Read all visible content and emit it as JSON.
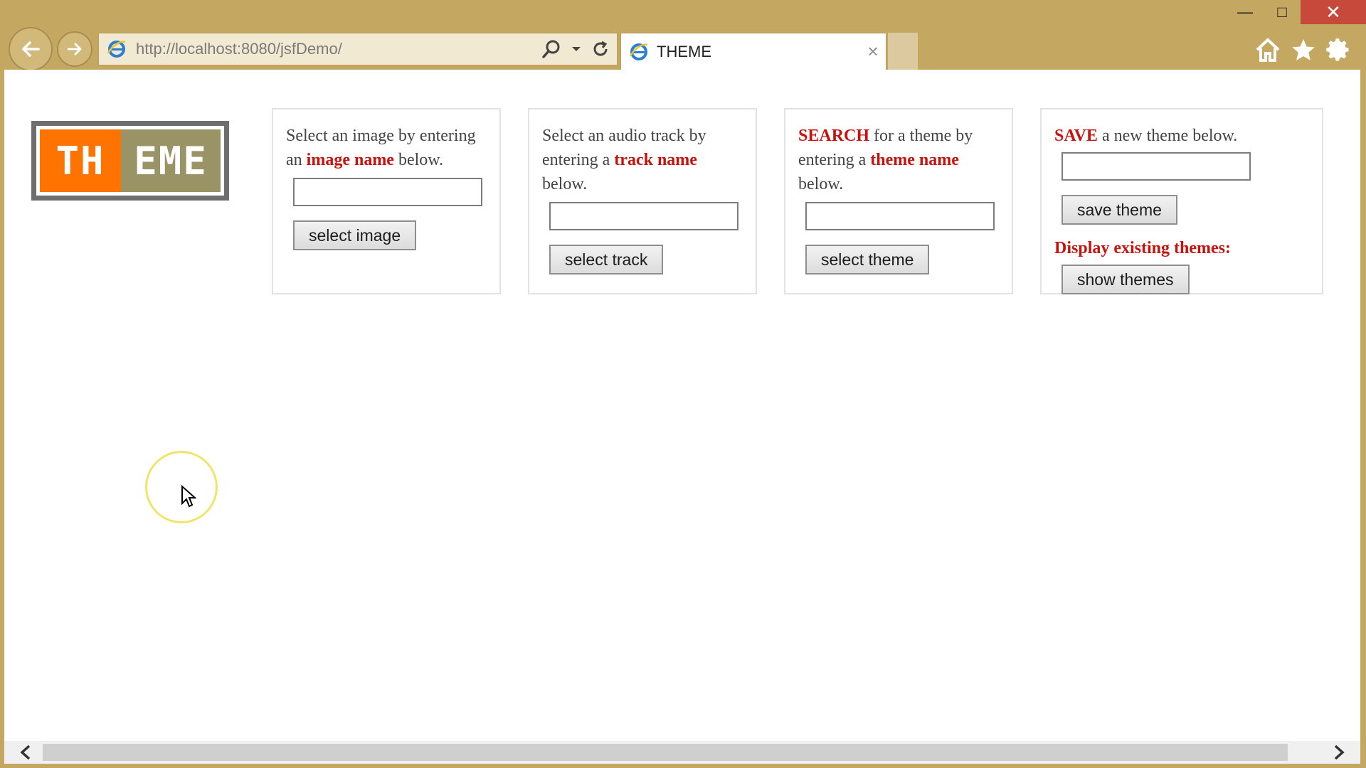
{
  "window": {
    "minimize_icon": "minimize-icon",
    "maximize_icon": "maximize-icon",
    "close_icon": "close-icon"
  },
  "browser": {
    "url_host": "http://localhost",
    "url_rest": ":8080/jsfDemo/",
    "tab_title": "THEME",
    "tab_close": "×"
  },
  "logo": {
    "left_text": "TH",
    "right_text": "EME"
  },
  "panels": {
    "image": {
      "text_before": "Select an image by entering an ",
      "highlight": "image name",
      "text_after": " below.",
      "button": "select image"
    },
    "track": {
      "text_before": "Select an audio track by entering a ",
      "highlight": "track name",
      "text_after": " below.",
      "button": "select track"
    },
    "search": {
      "lead": "SEARCH",
      "text_mid": " for a theme by entering a ",
      "highlight": "theme name",
      "text_after": " below.",
      "button": "select theme"
    },
    "save": {
      "lead": "SAVE",
      "text_after": " a new theme below.",
      "button": "save theme",
      "display_label": "Display existing themes:",
      "show_button": "show themes"
    }
  },
  "colors": {
    "chrome": "#c4a862",
    "accent_red": "#c8120e",
    "logo_orange": "#ff7300",
    "logo_olive": "#9a9366"
  }
}
